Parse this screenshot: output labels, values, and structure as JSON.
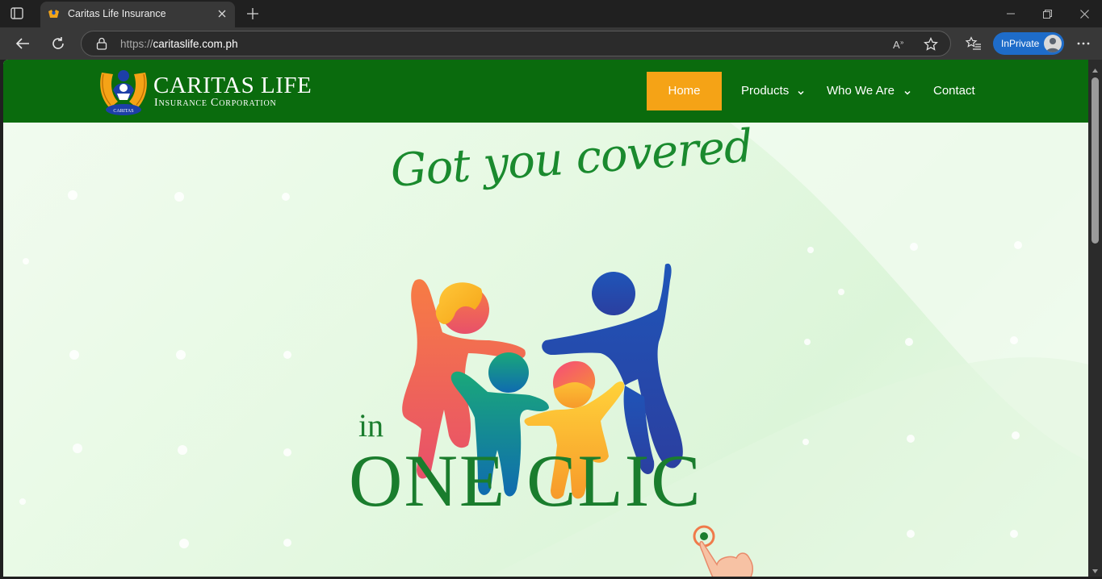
{
  "browser": {
    "tab_title": "Caritas Life Insurance",
    "url_scheme": "https://",
    "url_host": "caritaslife.com.ph",
    "inprivate_label": "InPrivate"
  },
  "site": {
    "logo_title": "CARITAS LIFE",
    "logo_subtitle": "Insurance Corporation",
    "logo_seal_text": "CARITAS",
    "nav": {
      "home": "Home",
      "products": "Products",
      "who_we_are": "Who We Are",
      "contact": "Contact"
    },
    "colors": {
      "header_bg": "#0a6b0d",
      "active_nav_bg": "#f5a316",
      "hero_text": "#1a7d2d"
    }
  },
  "hero": {
    "headline": "Got you covered",
    "line_in": "in",
    "line_oneclick": "ONE CLIC"
  },
  "icons": [
    "tab-actions-icon",
    "favicon-icon",
    "close-icon",
    "plus-icon",
    "minimize-icon",
    "restore-icon",
    "back-arrow-icon",
    "refresh-icon",
    "lock-icon",
    "read-aloud-icon",
    "favorite-star-icon",
    "favorites-icon",
    "more-icon",
    "chevron-down-icon",
    "pointing-hand-icon"
  ]
}
